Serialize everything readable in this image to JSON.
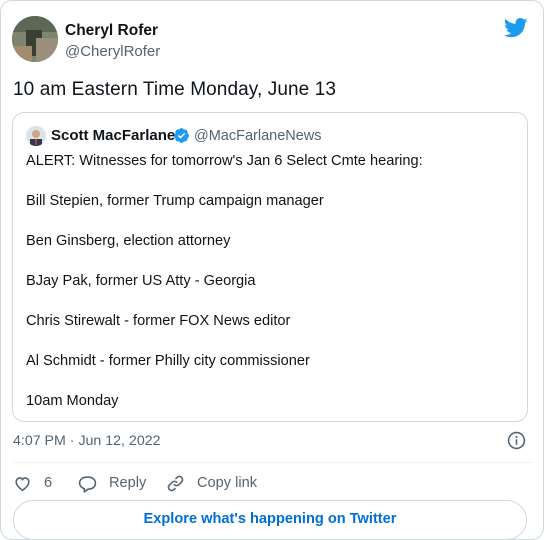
{
  "author": {
    "name": "Cheryl Rofer",
    "handle": "@CherylRofer"
  },
  "tweet": {
    "text": "10 am Eastern Time Monday, June 13",
    "timestamp": "4:07 PM · Jun 12, 2022"
  },
  "quoted": {
    "name": "Scott MacFarlane",
    "handle": "@MacFarlaneNews",
    "lines": [
      "ALERT:  Witnesses for tomorrow's Jan 6 Select Cmte hearing:",
      "Bill Stepien, former Trump campaign manager",
      "Ben Ginsberg, election attorney",
      "BJay Pak, former US Atty - Georgia",
      "Chris Stirewalt - former FOX News editor",
      "Al Schmidt - former Philly city commissioner",
      "10am Monday"
    ]
  },
  "actions": {
    "like_count": "6",
    "reply_label": "Reply",
    "copy_label": "Copy link"
  },
  "footer": {
    "explore_label": "Explore what's happening on Twitter"
  },
  "colors": {
    "twitter_blue": "#1d9bf0",
    "link_blue": "#006fd6",
    "muted": "#536471",
    "border": "#cfd9de"
  },
  "icons": [
    "twitter-bird-icon",
    "verified-badge-icon",
    "info-icon",
    "heart-icon",
    "reply-icon",
    "copy-link-icon"
  ]
}
